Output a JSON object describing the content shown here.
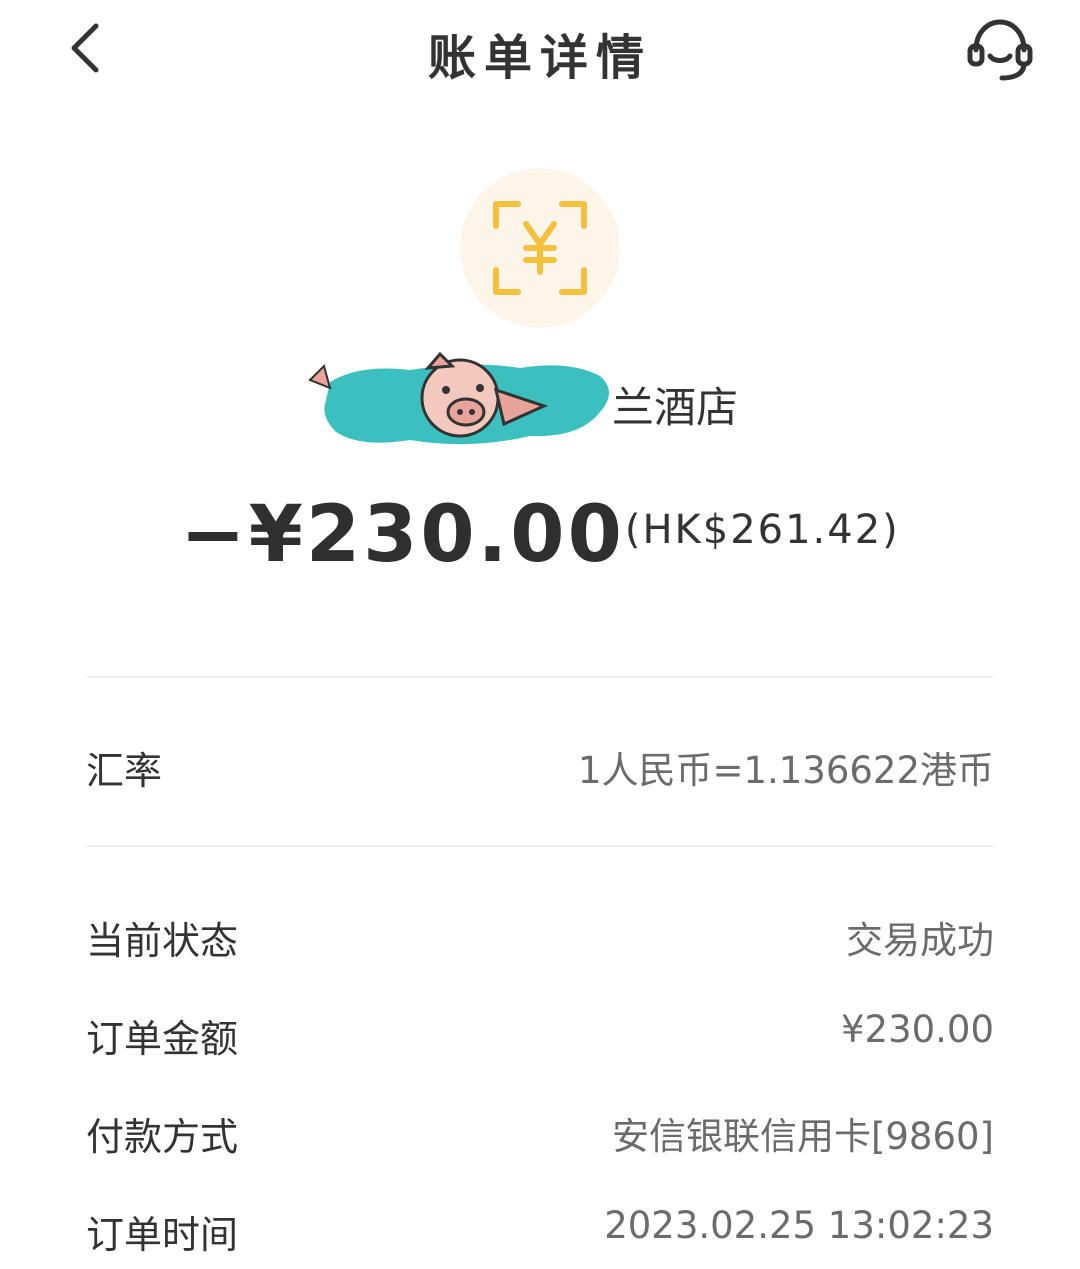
{
  "header": {
    "title": "账单详情",
    "back_icon": "chevron-left-icon",
    "support_icon": "headset-icon"
  },
  "merchant": {
    "icon": "yuan-scan-icon",
    "icon_color": "#f5c13c",
    "icon_bg": "#fdf5ea",
    "name_visible": "兰酒店",
    "redaction": "pig-sticker-over-teal-scribble"
  },
  "amount": {
    "main": "−¥230.00",
    "converted": "(HK$261.42)"
  },
  "exchange": {
    "label": "汇率",
    "value": "1人民币=1.136622港币"
  },
  "details": [
    {
      "label": "当前状态",
      "value": "交易成功"
    },
    {
      "label": "订单金额",
      "value": "¥230.00"
    },
    {
      "label": "付款方式",
      "value": "安信银联信用卡[9860]"
    },
    {
      "label": "订单时间",
      "value": "2023.02.25 13:02:23"
    }
  ],
  "colors": {
    "scribble": "#3bbfbf",
    "pig": "#f3c9bd"
  }
}
